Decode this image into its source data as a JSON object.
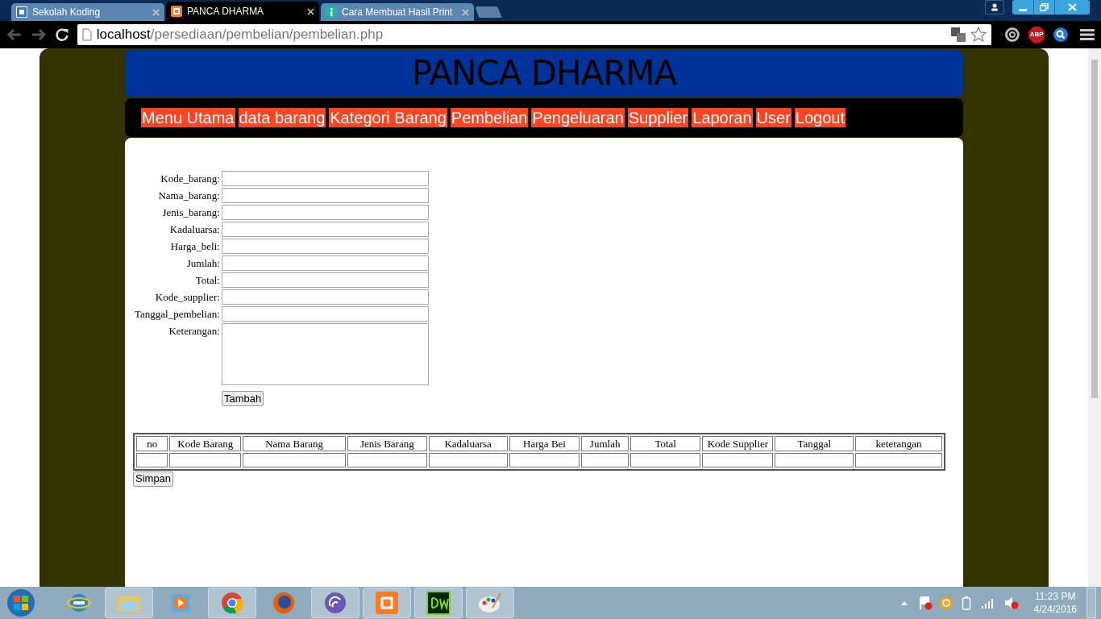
{
  "browser": {
    "tabs": [
      {
        "title": "Sekolah Koding",
        "selected": false
      },
      {
        "title": "PANCA DHARMA",
        "selected": true
      },
      {
        "title": "Cara Membuat Hasil Print",
        "selected": false
      }
    ],
    "address": {
      "host": "localhost",
      "path": "/persediaan/pembelian/pembelian.php"
    },
    "extensions": [
      {
        "kind": "abp",
        "label": "ABP"
      }
    ]
  },
  "page": {
    "header": "PANCA DHARMA",
    "nav": [
      "Menu Utama",
      "data barang",
      "Kategori Barang",
      "Pembelian",
      "Pengeluaran",
      "Supplier",
      "Laporan",
      "User",
      "Logout"
    ],
    "form": {
      "fields": [
        {
          "label": "Kode_barang:",
          "kind": "text"
        },
        {
          "label": "Nama_barang:",
          "kind": "text"
        },
        {
          "label": "Jenis_barang:",
          "kind": "text"
        },
        {
          "label": "Kadaluarsa:",
          "kind": "text"
        },
        {
          "label": "Harga_beli:",
          "kind": "text"
        },
        {
          "label": "Jumlah:",
          "kind": "text"
        },
        {
          "label": "Total:",
          "kind": "text"
        },
        {
          "label": "Kode_supplier:",
          "kind": "text"
        },
        {
          "label": "Tanggal_pembelian:",
          "kind": "text"
        },
        {
          "label": "Keterangan:",
          "kind": "textarea"
        }
      ],
      "submit": "Tambah"
    },
    "table": {
      "columns": [
        "no",
        "Kode Barang",
        "Nama Barang",
        "Jenis Barang",
        "Kadaluarsa",
        "Harga Bei",
        "Jumlah",
        "Total",
        "Kode Supplier",
        "Tanggal",
        "keterangan"
      ]
    },
    "save_button": "Simpan"
  },
  "taskbar": {
    "time": "11:23 PM",
    "date": "4/24/2016"
  }
}
